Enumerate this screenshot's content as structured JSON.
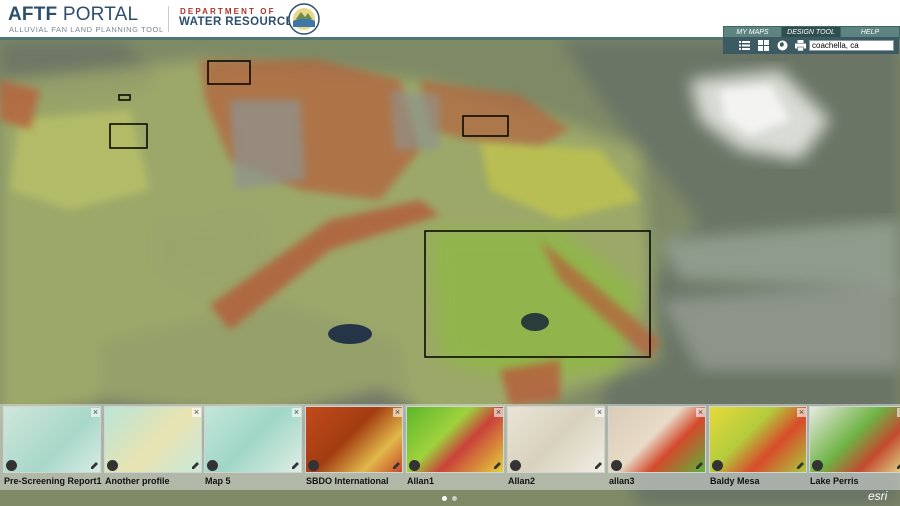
{
  "header": {
    "title_bold": "AFTF",
    "title_rest": " PORTAL",
    "subtitle": "ALLUVIAL FAN LAND PLANNING TOOL",
    "dept_line1": "DEPARTMENT OF",
    "dept_line2": "WATER RESOURCES"
  },
  "tabs": {
    "my_maps": "MY MAPS",
    "design_tool": "DESIGN TOOL",
    "help": "HELP"
  },
  "toolbar": {
    "icons": [
      "list-icon",
      "grid-icon",
      "globe-icon",
      "print-icon"
    ],
    "search_value": "coachella, ca"
  },
  "thumbnails": [
    {
      "label": "Pre-Screening Report1"
    },
    {
      "label": "Another profile"
    },
    {
      "label": "Map 5"
    },
    {
      "label": "SBDO International"
    },
    {
      "label": "Allan1"
    },
    {
      "label": "Allan2"
    },
    {
      "label": "allan3"
    },
    {
      "label": "Baldy Mesa"
    },
    {
      "label": "Lake Perris"
    }
  ],
  "carousel": {
    "pages": 2,
    "current": 1
  },
  "attribution": "esri",
  "colors": {
    "header_blue": "#2d4f6e",
    "dept_red": "#b33027",
    "tab_teal": "#5e8481",
    "tab_active": "#2f4e4e",
    "toolbar": "#3c5a62"
  }
}
